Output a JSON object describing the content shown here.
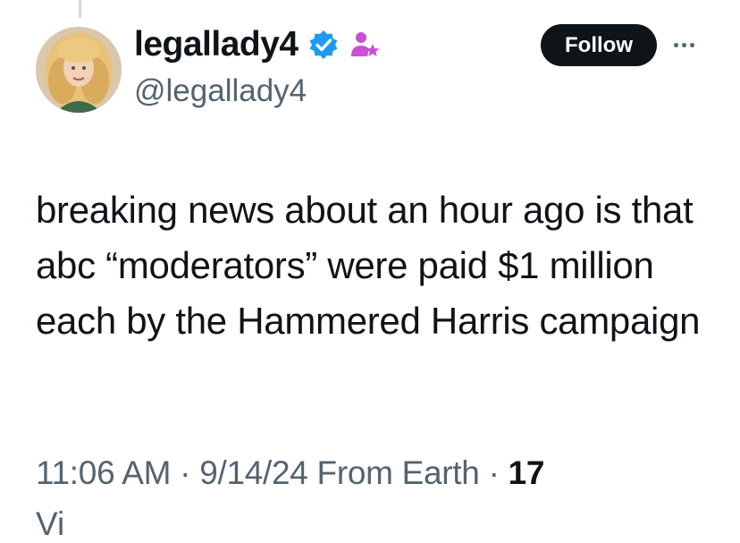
{
  "author": {
    "display_name": "legallady4",
    "handle": "@legallady4",
    "verified_badge_icon": "verified-check-icon",
    "extra_badge_icon": "person-star-icon",
    "avatar_icon": "profile-avatar"
  },
  "actions": {
    "follow_label": "Follow",
    "more_icon": "more-options-icon"
  },
  "tweet": {
    "text": "breaking news about an hour ago is that abc “moderators” were paid $1 million each by the Hammered Harris campaign"
  },
  "meta": {
    "time": "11:06 AM",
    "separator": "·",
    "date": "9/14/24",
    "source": "From Earth",
    "views_count": "17",
    "views_label_partial": "Vi"
  },
  "colors": {
    "text": "#0f1419",
    "secondary": "#536471",
    "verified": "#1d9bf0",
    "badge_purple": "#c94fd6"
  }
}
